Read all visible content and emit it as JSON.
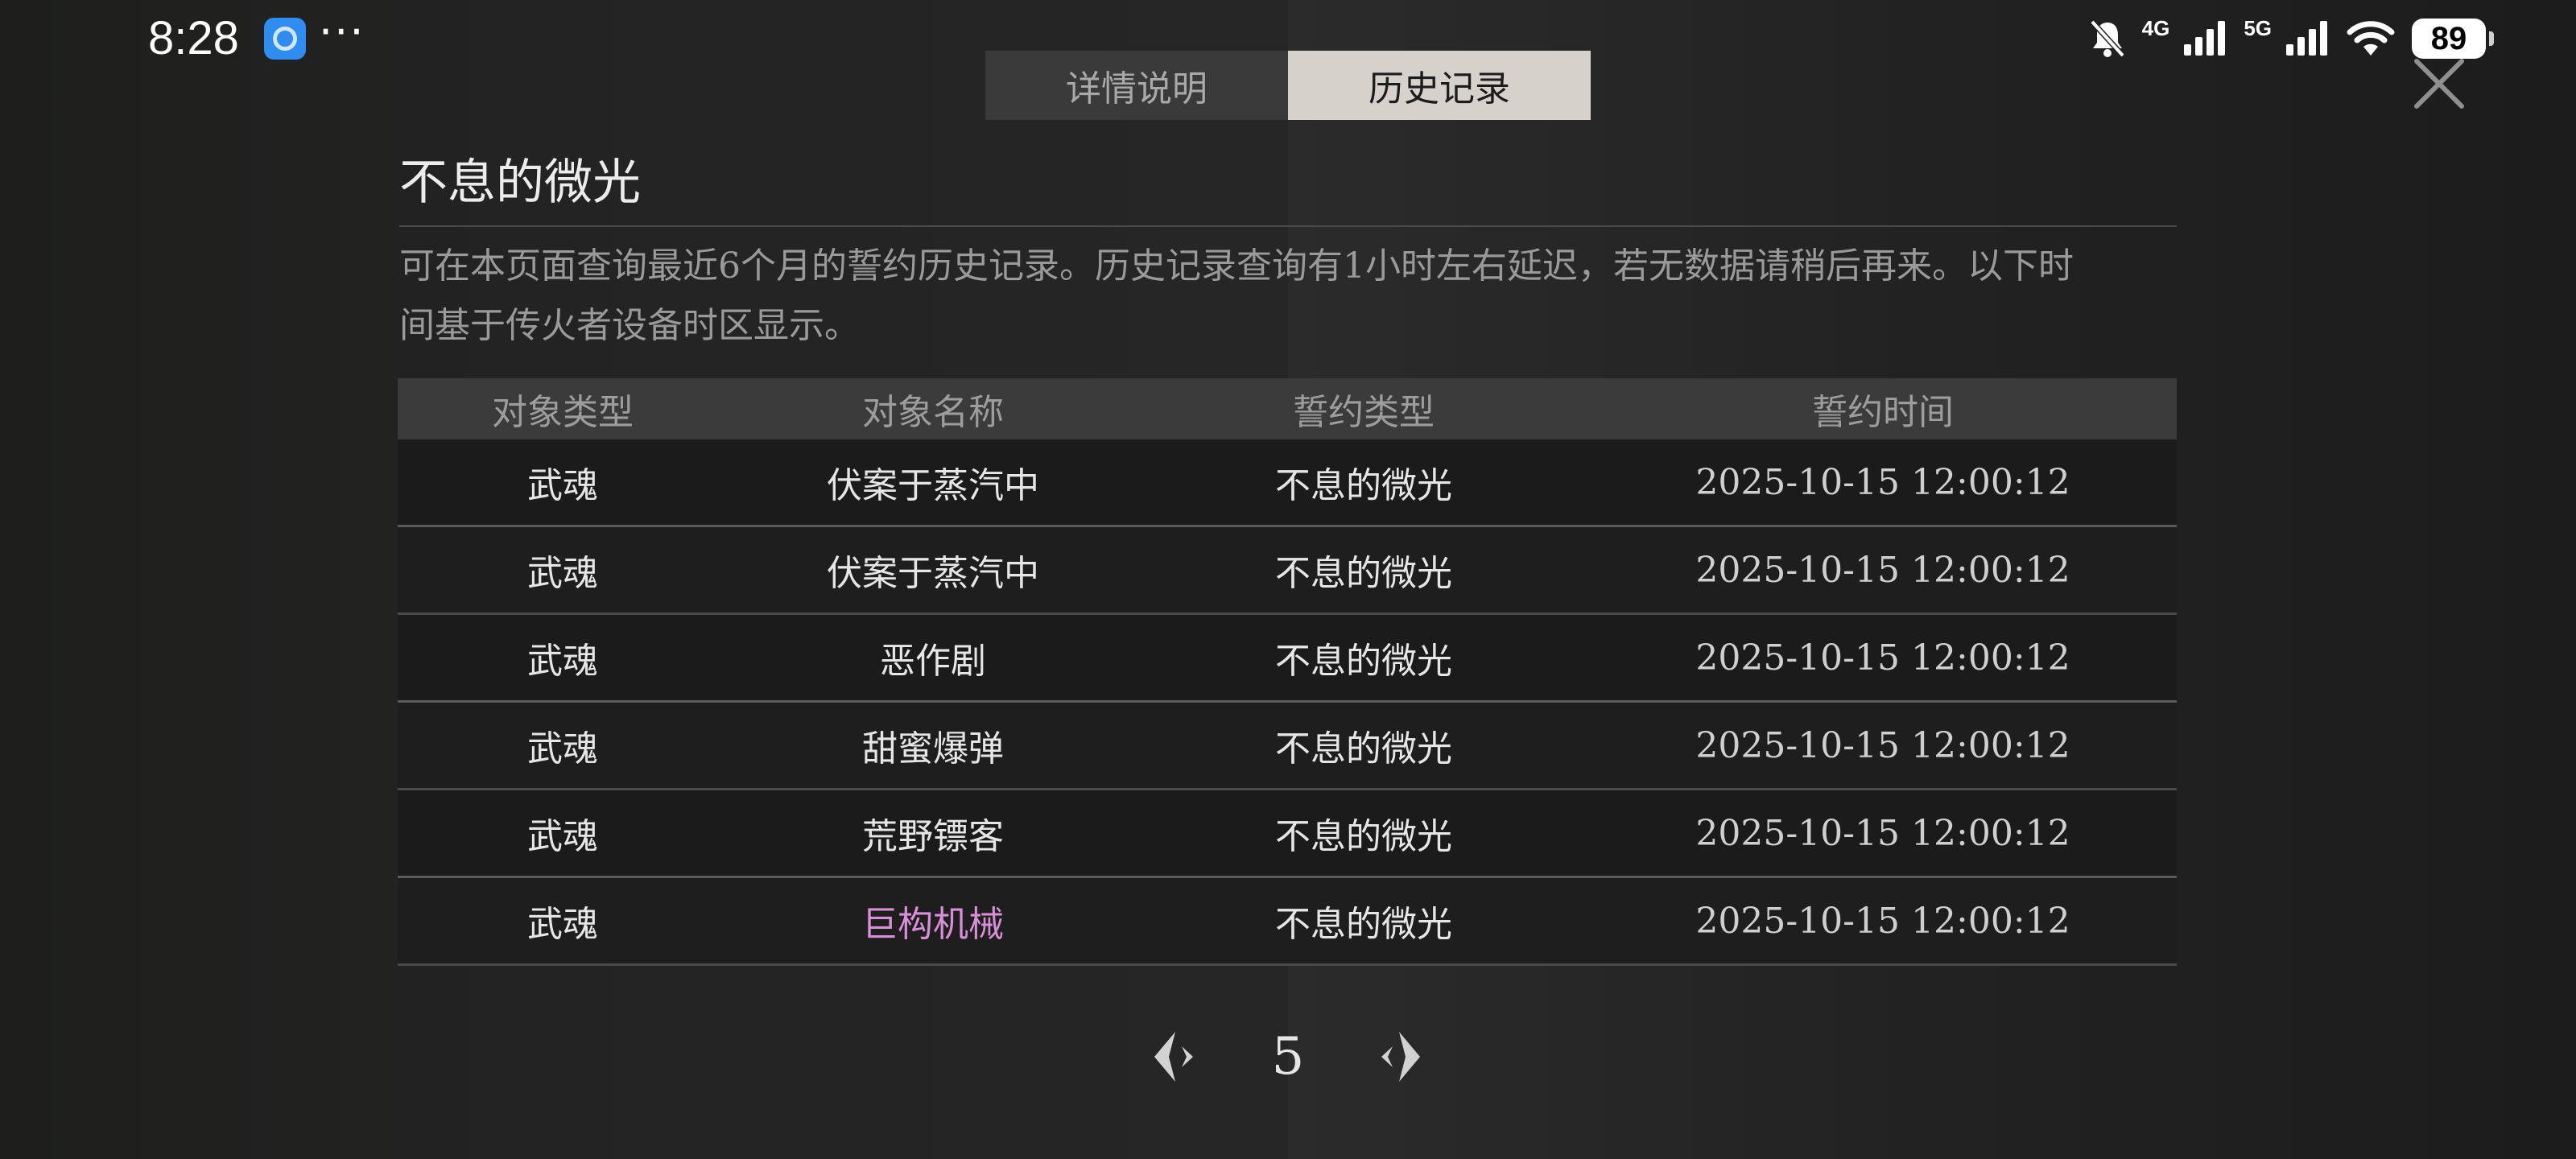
{
  "status_bar": {
    "time": "8:28",
    "more": "···",
    "net_4g": "4G",
    "net_5g": "5G",
    "battery": "89"
  },
  "tabs": [
    {
      "label": "详情说明",
      "active": false
    },
    {
      "label": "历史记录",
      "active": true
    }
  ],
  "page": {
    "title": "不息的微光",
    "description_line1": "可在本页面查询最近6个月的誓约历史记录。历史记录查询有1小时左右延迟，若无数据请稍后再来。以下时",
    "description_line2": "间基于传火者设备时区显示。"
  },
  "table": {
    "headers": [
      "对象类型",
      "对象名称",
      "誓约类型",
      "誓约时间"
    ],
    "rows": [
      {
        "type": "武魂",
        "name": "伏案于蒸汽中",
        "oath": "不息的微光",
        "time": "2025-10-15 12:00:12"
      },
      {
        "type": "武魂",
        "name": "伏案于蒸汽中",
        "oath": "不息的微光",
        "time": "2025-10-15 12:00:12"
      },
      {
        "type": "武魂",
        "name": "恶作剧",
        "oath": "不息的微光",
        "time": "2025-10-15 12:00:12"
      },
      {
        "type": "武魂",
        "name": "甜蜜爆弹",
        "oath": "不息的微光",
        "time": "2025-10-15 12:00:12"
      },
      {
        "type": "武魂",
        "name": "荒野镖客",
        "oath": "不息的微光",
        "time": "2025-10-15 12:00:12"
      },
      {
        "type": "武魂",
        "name": "巨构机械",
        "oath": "不息的微光",
        "time": "2025-10-15 12:00:12"
      }
    ],
    "highlight_color": "#d98ed8"
  },
  "pagination": {
    "current_page": "5",
    "prev_icon": "arrow-left-icon",
    "next_icon": "arrow-right-icon"
  }
}
